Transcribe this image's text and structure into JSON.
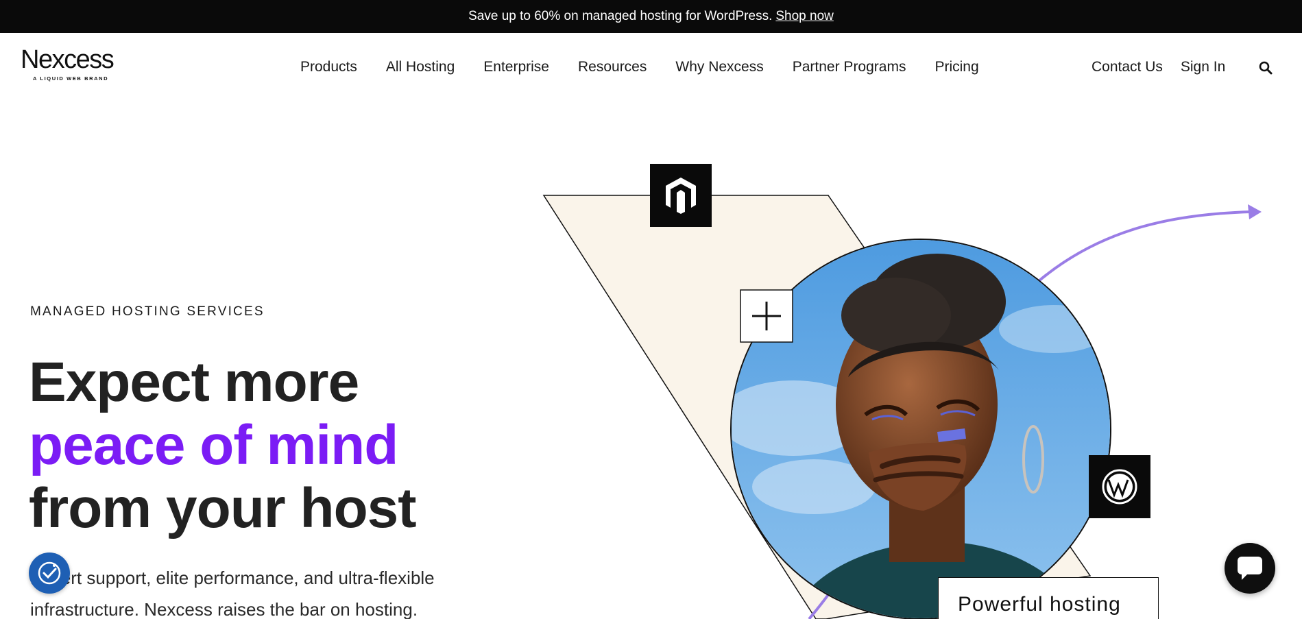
{
  "promo": {
    "text": "Save up to 60% on managed hosting for WordPress.",
    "link": "Shop now"
  },
  "brand": {
    "name": "Nexcess",
    "tagline": "A LIQUID WEB BRAND"
  },
  "nav": {
    "main": [
      "Products",
      "All Hosting",
      "Enterprise",
      "Resources",
      "Why Nexcess",
      "Partner Programs",
      "Pricing"
    ],
    "right": [
      "Contact Us",
      "Sign In"
    ],
    "search_icon": "search-icon"
  },
  "hero": {
    "eyebrow": "MANAGED HOSTING SERVICES",
    "headline_line1": "Expect more",
    "headline_line2": "peace of mind",
    "headline_line3": "from your host",
    "lede": "Expert support, elite performance, and ultra-flexible infrastructure. Nexcess raises the bar on hosting.",
    "tag_card": "Powerful hosting",
    "badges": [
      "magento-icon",
      "plus-icon",
      "wordpress-icon"
    ]
  },
  "widgets": {
    "accessibility": "accessibility-icon",
    "chat": "chat-icon"
  },
  "colors": {
    "promo_bg": "#0a0a0a",
    "accent_purple": "#7b1cf5",
    "arrow_purple": "#9a7de6",
    "cream": "#faf4ea",
    "a11y_blue": "#1e5fb4"
  }
}
